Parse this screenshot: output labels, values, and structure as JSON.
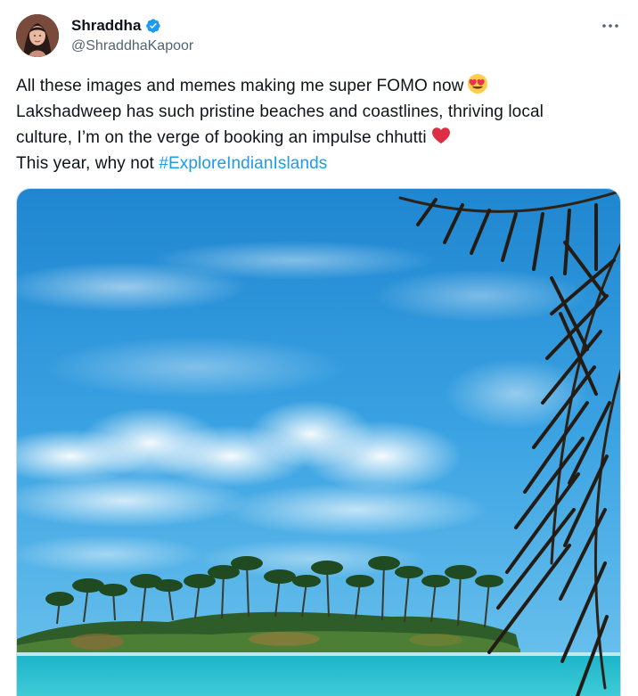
{
  "author": {
    "display_name": "Shraddha",
    "handle": "@ShraddhaKapoor",
    "verified": true,
    "avatar_icon": "profile-photo"
  },
  "tweet": {
    "line1": "All these images and memes making me super FOMO now",
    "line1_emoji": "heart-eyes-emoji",
    "line2": "Lakshadweep has such pristine beaches and coastlines, thriving local",
    "line3": "culture, I’m on the verge of booking an impulse chhutti",
    "line3_emoji": "red-heart-emoji",
    "line4_prefix": "This year, why not",
    "hashtag": "#ExploreIndianIslands"
  },
  "media": {
    "subject": "tropical island with palm trees, turquoise sea and blue sky"
  },
  "colors": {
    "link": "#1d9bf0",
    "verified_badge": "#1d9bf0",
    "text": "#0f1419",
    "secondary": "#536471"
  },
  "icons": [
    "verified-badge-icon",
    "more-options-icon"
  ]
}
